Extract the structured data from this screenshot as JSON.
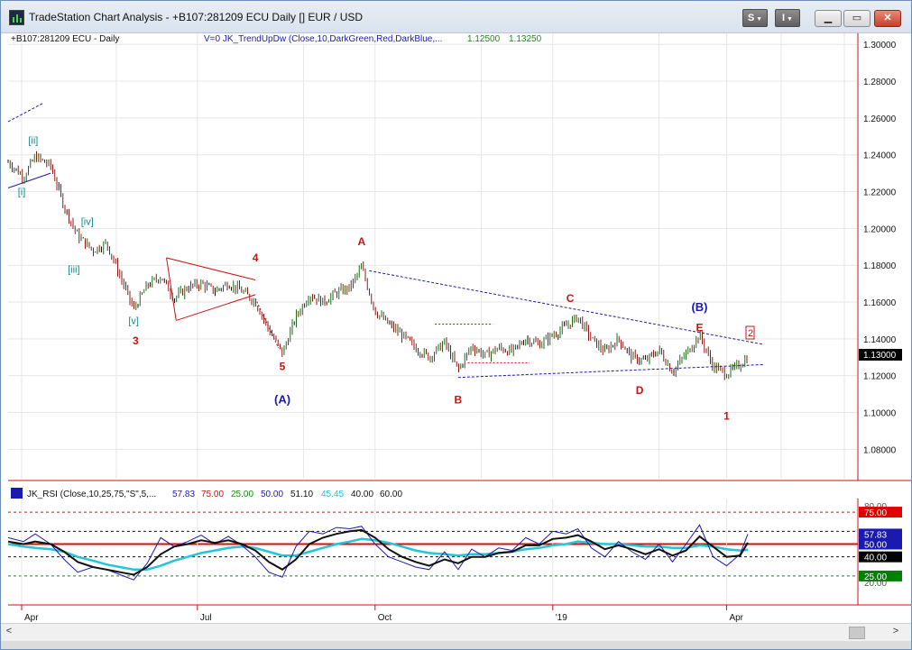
{
  "window": {
    "title": "TradeStation Chart Analysis - +B107:281209 ECU Daily [] EUR / USD",
    "s_menu_label": "S",
    "i_menu_label": "I"
  },
  "chart": {
    "symbol_label": "+B107:281209 ECU - Daily",
    "indicator_label": "V=0  JK_TrendUpDw  (Close,10,DarkGreen,Red,DarkBlue,...",
    "indicator_val1": "1.12500",
    "indicator_val2": "1.13250",
    "last_price": "1.13000",
    "y_ticks": [
      "1.30000",
      "1.28000",
      "1.26000",
      "1.24000",
      "1.22000",
      "1.20000",
      "1.18000",
      "1.16000",
      "1.14000",
      "1.12000",
      "1.10000",
      "1.08000"
    ],
    "y_range": [
      1.064,
      1.306
    ],
    "wave_labels": [
      {
        "text": "[ii]",
        "date": "2018-04-07",
        "price": 1.246,
        "color": "#0e8a8a"
      },
      {
        "text": "[i]",
        "date": "2018-04-01",
        "price": 1.218,
        "color": "#0e8a8a"
      },
      {
        "text": "[iv]",
        "date": "2018-05-05",
        "price": 1.202,
        "color": "#0e8a8a"
      },
      {
        "text": "[iii]",
        "date": "2018-04-28",
        "price": 1.176,
        "color": "#0e8a8a"
      },
      {
        "text": "[v]",
        "date": "2018-05-29",
        "price": 1.148,
        "color": "#0e8a8a"
      },
      {
        "text": "3",
        "date": "2018-05-30",
        "price": 1.137,
        "color": "#cc1111"
      },
      {
        "text": "4",
        "date": "2018-07-31",
        "price": 1.182,
        "color": "#cc1111"
      },
      {
        "text": "5",
        "date": "2018-08-14",
        "price": 1.123,
        "color": "#cc1111"
      },
      {
        "text": "(A)",
        "date": "2018-08-14",
        "price": 1.105,
        "color": "#1a1ab0"
      },
      {
        "text": "A",
        "date": "2018-09-24",
        "price": 1.191,
        "color": "#cc1111"
      },
      {
        "text": "B",
        "date": "2018-11-13",
        "price": 1.105,
        "color": "#cc1111"
      },
      {
        "text": "C",
        "date": "2019-01-10",
        "price": 1.16,
        "color": "#cc1111"
      },
      {
        "text": "D",
        "date": "2019-02-15",
        "price": 1.11,
        "color": "#cc1111"
      },
      {
        "text": "(B)",
        "date": "2019-03-18",
        "price": 1.155,
        "color": "#1a1ab0"
      },
      {
        "text": "E",
        "date": "2019-03-18",
        "price": 1.144,
        "color": "#cc1111"
      },
      {
        "text": "1",
        "date": "2019-04-01",
        "price": 1.096,
        "color": "#cc1111"
      }
    ],
    "box_label": "2"
  },
  "rsi": {
    "label": "JK_RSI  (Close,10,25,75,\"S\",5,...",
    "values": [
      {
        "text": "57.83",
        "color": "#1a1ab0"
      },
      {
        "text": "75.00",
        "color": "#cc1111"
      },
      {
        "text": "25.00",
        "color": "#1a8a1a"
      },
      {
        "text": "50.00",
        "color": "#1a1ab0"
      },
      {
        "text": "51.10",
        "color": "#111111"
      },
      {
        "text": "45.45",
        "color": "#22c6d6"
      },
      {
        "text": "40.00",
        "color": "#111111"
      },
      {
        "text": "60.00",
        "color": "#111111"
      }
    ],
    "axis_labels": [
      "80.00",
      "75.00",
      "57.83",
      "50.00",
      "40.00",
      "25.00",
      "20.00"
    ],
    "levels": {
      "top": 80,
      "upper": 75,
      "high": 60,
      "mid": 50,
      "low": 40,
      "lower": 25,
      "bottom": 20
    }
  },
  "x_axis": {
    "labels": [
      {
        "text": "Apr",
        "date": "2018-04-01"
      },
      {
        "text": "Jul",
        "date": "2018-07-01"
      },
      {
        "text": "Oct",
        "date": "2018-10-01"
      },
      {
        "text": "'19",
        "date": "2019-01-01"
      },
      {
        "text": "Apr",
        "date": "2019-04-01"
      }
    ]
  },
  "colors": {
    "up_bar": "#1a6a1a",
    "down_bar": "#8a1a1a",
    "neutral_bar": "#111111",
    "trend_blue": "#1a1ab0",
    "trend_red": "#cc1111",
    "rsi_cyan": "#22c6d6"
  },
  "chart_data": {
    "type": "line",
    "title": "+B107:281209 ECU - Daily",
    "xlabel": "",
    "ylabel": "",
    "ylim": [
      1.064,
      1.306
    ],
    "series": [
      {
        "name": "",
        "x": [
          "2018-03-25",
          "2018-04-02",
          "2018-04-08",
          "2018-04-16",
          "2018-04-23",
          "2018-04-30",
          "2018-05-08",
          "2018-05-15",
          "2018-05-22",
          "2018-05-29",
          "2018-06-05",
          "2018-06-12",
          "2018-06-19",
          "2018-06-26",
          "2018-07-03",
          "2018-07-10",
          "2018-07-17",
          "2018-07-24",
          "2018-07-31",
          "2018-08-07",
          "2018-08-14",
          "2018-08-21",
          "2018-08-28",
          "2018-09-04",
          "2018-09-11",
          "2018-09-18",
          "2018-09-24",
          "2018-10-01",
          "2018-10-08",
          "2018-10-15",
          "2018-10-22",
          "2018-10-29",
          "2018-11-06",
          "2018-11-13",
          "2018-11-20",
          "2018-11-27",
          "2018-12-04",
          "2018-12-11",
          "2018-12-18",
          "2018-12-25",
          "2019-01-01",
          "2019-01-08",
          "2019-01-14",
          "2019-01-21",
          "2019-01-28",
          "2019-02-04",
          "2019-02-11",
          "2019-02-18",
          "2019-02-25",
          "2019-03-04",
          "2019-03-11",
          "2019-03-18",
          "2019-03-25",
          "2019-04-01",
          "2019-04-08",
          "2019-04-12"
        ],
        "values": [
          1.236,
          1.228,
          1.239,
          1.234,
          1.212,
          1.196,
          1.188,
          1.192,
          1.174,
          1.156,
          1.169,
          1.174,
          1.162,
          1.168,
          1.17,
          1.166,
          1.17,
          1.166,
          1.16,
          1.145,
          1.132,
          1.152,
          1.164,
          1.16,
          1.165,
          1.168,
          1.179,
          1.155,
          1.148,
          1.142,
          1.135,
          1.13,
          1.138,
          1.123,
          1.136,
          1.131,
          1.135,
          1.133,
          1.14,
          1.137,
          1.142,
          1.147,
          1.152,
          1.14,
          1.133,
          1.14,
          1.13,
          1.128,
          1.134,
          1.122,
          1.132,
          1.142,
          1.125,
          1.121,
          1.126,
          1.13
        ]
      }
    ],
    "rsi_series": [
      {
        "name": "JK_RSI",
        "values": [
          55,
          52,
          58,
          50,
          38,
          28,
          32,
          30,
          26,
          22,
          35,
          55,
          48,
          52,
          57,
          50,
          56,
          49,
          40,
          28,
          24,
          48,
          60,
          58,
          63,
          62,
          64,
          50,
          40,
          36,
          32,
          30,
          44,
          30,
          46,
          40,
          47,
          45,
          55,
          50,
          60,
          58,
          62,
          47,
          40,
          52,
          44,
          38,
          50,
          36,
          50,
          65,
          40,
          33,
          42,
          57.83
        ]
      },
      {
        "name": "signal",
        "values": [
          52,
          50,
          52,
          50,
          44,
          36,
          32,
          30,
          28,
          26,
          32,
          42,
          48,
          50,
          53,
          51,
          53,
          50,
          45,
          36,
          30,
          38,
          50,
          55,
          58,
          60,
          61,
          55,
          46,
          40,
          36,
          33,
          38,
          35,
          40,
          40,
          43,
          44,
          49,
          49,
          54,
          55,
          57,
          52,
          46,
          49,
          46,
          42,
          46,
          41,
          45,
          56,
          48,
          40,
          41,
          51.1
        ]
      },
      {
        "name": "avg",
        "values": [
          50,
          48,
          47,
          46,
          44,
          40,
          37,
          34,
          32,
          30,
          30,
          33,
          37,
          40,
          43,
          45,
          47,
          48,
          47,
          44,
          41,
          41,
          44,
          47,
          50,
          52,
          54,
          53,
          51,
          48,
          45,
          43,
          42,
          41,
          42,
          42,
          43,
          44,
          46,
          47,
          49,
          50,
          52,
          51,
          50,
          50,
          49,
          48,
          48,
          47,
          47,
          49,
          48,
          46,
          45,
          45.45
        ]
      }
    ]
  }
}
